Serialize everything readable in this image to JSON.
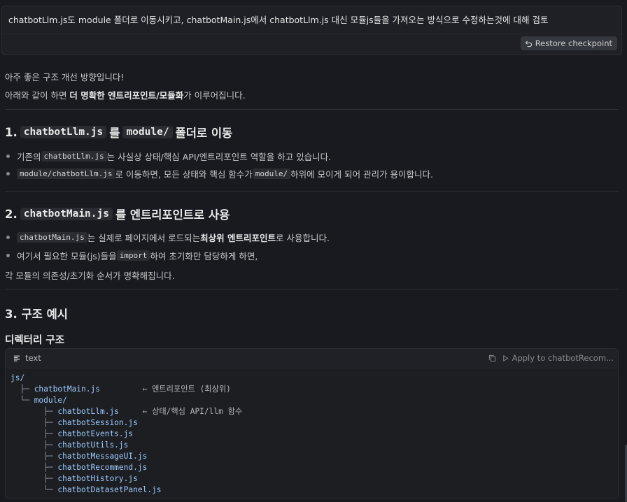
{
  "prompt": {
    "text": "chatbotLlm.js도 module 폴더로 이동시키고, chatbotMain.js에서 chatbotLlm.js 대신 모듈js들을 가져오는 방식으로 수정하는것에 대해 검토",
    "restore_label": "Restore checkpoint"
  },
  "intro": {
    "line1": "아주 좋은 구조 개선 방향입니다!",
    "line2_pre": "아래와 같이 하면 ",
    "line2_bold": "더 명확한 엔트리포인트/모듈화",
    "line2_post": "가 이루어집니다."
  },
  "section1": {
    "num": "1.",
    "code1": "chatbotLlm.js",
    "mid": "를",
    "code2": "module/",
    "tail": "폴더로 이동",
    "bullets": [
      {
        "pre": "기존의 ",
        "code": "chatbotLlm.js",
        "post": " 는 사실상 상태/핵심 API/엔트리포인트 역할을 하고 있습니다."
      },
      {
        "code": "module/chatbotLlm.js",
        "mid": " 로 이동하면, 모든 상태와 핵심 함수가 ",
        "code2": "module/",
        "post": " 하위에 모이게 되어 관리가 용이합니다."
      }
    ]
  },
  "section2": {
    "num": "2.",
    "code1": "chatbotMain.js",
    "tail": "를 엔트리포인트로 사용",
    "bullets": [
      {
        "code": "chatbotMain.js",
        "mid": " 는 실제로 페이지에서 로드되는 ",
        "bold": "최상위 엔트리포인트",
        "post": "로 사용합니다."
      },
      {
        "pre": "여기서 필요한 모듈(js)들을 ",
        "code": "import",
        "post": " 하여 초기화만 담당하게 하면,"
      }
    ],
    "continuation": "각 모듈의 의존성/초기화 순서가 명확해집니다."
  },
  "section3": {
    "title": "3. 구조 예시",
    "subtitle": "디렉터리 구조"
  },
  "code_block": {
    "language": "text",
    "apply_label": "Apply to chatbotRecom...",
    "lines": [
      {
        "prefix": "",
        "name": "js/",
        "comment": ""
      },
      {
        "prefix": "  ├─ ",
        "name": "chatbotMain.js",
        "comment": "         ← 엔트리포인트 (최상위)"
      },
      {
        "prefix": "  └─ ",
        "name": "module/",
        "comment": ""
      },
      {
        "prefix": "       ├─ ",
        "name": "chatbotLlm.js",
        "comment": "     ← 상태/핵심 API/llm 함수"
      },
      {
        "prefix": "       ├─ ",
        "name": "chatbotSession.js",
        "comment": ""
      },
      {
        "prefix": "       ├─ ",
        "name": "chatbotEvents.js",
        "comment": ""
      },
      {
        "prefix": "       ├─ ",
        "name": "chatbotUtils.js",
        "comment": ""
      },
      {
        "prefix": "       ├─ ",
        "name": "chatbotMessageUI.js",
        "comment": ""
      },
      {
        "prefix": "       ├─ ",
        "name": "chatbotRecommend.js",
        "comment": ""
      },
      {
        "prefix": "       ├─ ",
        "name": "chatbotHistory.js",
        "comment": ""
      },
      {
        "prefix": "       └─ ",
        "name": "chatbotDatasetPanel.js",
        "comment": ""
      }
    ]
  }
}
